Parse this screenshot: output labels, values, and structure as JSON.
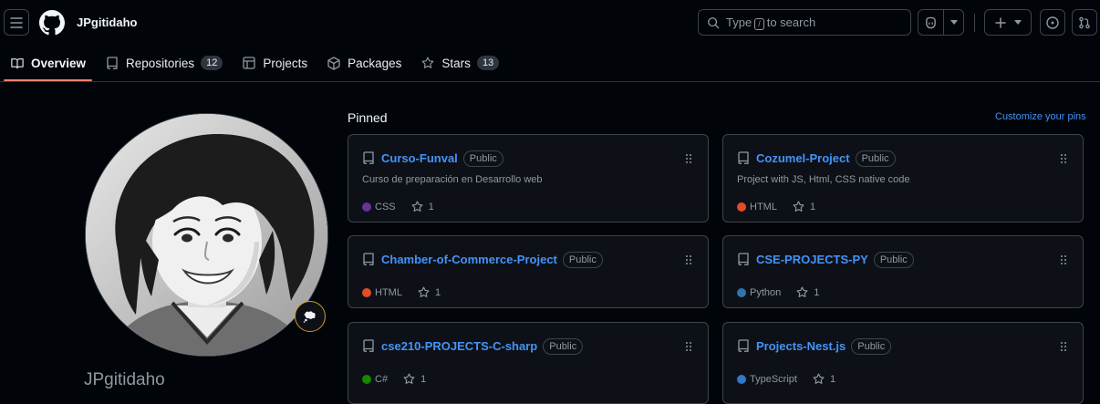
{
  "header": {
    "owner": "JPgitidaho",
    "search": {
      "prefix": "Type",
      "key": "/",
      "suffix": "to search"
    }
  },
  "tabs": [
    {
      "label": "Overview",
      "icon": "book-icon",
      "selected": true
    },
    {
      "label": "Repositories",
      "icon": "repo-icon",
      "count": "12"
    },
    {
      "label": "Projects",
      "icon": "table-icon"
    },
    {
      "label": "Packages",
      "icon": "package-icon"
    },
    {
      "label": "Stars",
      "icon": "star-icon",
      "count": "13"
    }
  ],
  "profile": {
    "login": "JPgitidaho"
  },
  "pinned": {
    "title": "Pinned",
    "customize": "Customize your pins",
    "cards": [
      {
        "name": "Curso-Funval",
        "visibility": "Public",
        "description": "Curso de preparación en Desarrollo web",
        "language": "CSS",
        "language_color": "#663399",
        "stars": "1"
      },
      {
        "name": "Cozumel-Project",
        "visibility": "Public",
        "description": "Project with JS, Html, CSS native code",
        "language": "HTML",
        "language_color": "#e34c26",
        "stars": "1"
      },
      {
        "name": "Chamber-of-Commerce-Project",
        "visibility": "Public",
        "description": "",
        "language": "HTML",
        "language_color": "#e34c26",
        "stars": "1"
      },
      {
        "name": "CSE-PROJECTS-PY",
        "visibility": "Public",
        "description": "",
        "language": "Python",
        "language_color": "#3572a5",
        "stars": "1"
      },
      {
        "name": "cse210-PROJECTS-C-sharp",
        "visibility": "Public",
        "description": "",
        "language": "C#",
        "language_color": "#178600",
        "stars": "1"
      },
      {
        "name": "Projects-Nest.js",
        "visibility": "Public",
        "description": "",
        "language": "TypeScript",
        "language_color": "#3178c6",
        "stars": "1"
      }
    ]
  }
}
